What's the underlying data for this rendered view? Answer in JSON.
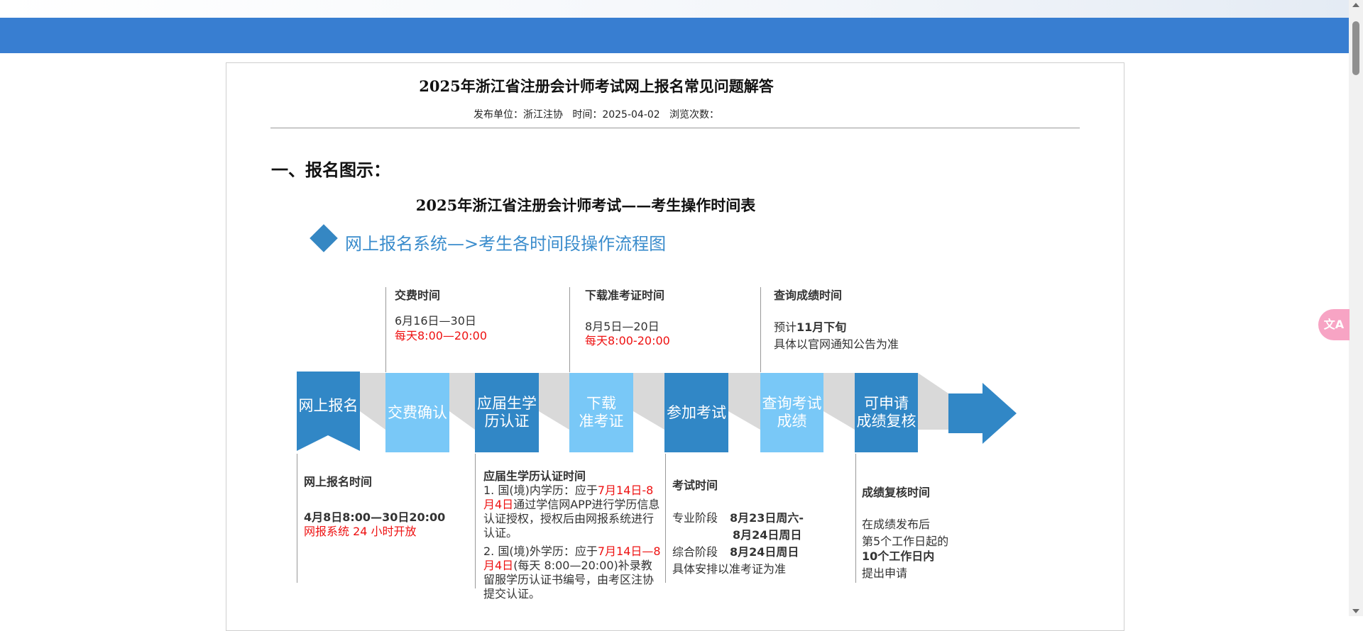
{
  "article": {
    "title": "2025年浙江省注册会计师考试网上报名常见问题解答",
    "meta": "发布单位：浙江注协   时间：2025-04-02   浏览次数："
  },
  "section_heading": "一、报名图示：",
  "schedule_title": "2025年浙江省注册会计师考试——考生操作时间表",
  "flow_title": "网上报名系统—>考生各时间段操作流程图",
  "flow_boxes": [
    {
      "l1": "网上报名",
      "l2": ""
    },
    {
      "l1": "交费确认",
      "l2": ""
    },
    {
      "l1": "应届生学",
      "l2": "历认证"
    },
    {
      "l1": "下载",
      "l2": "准考证"
    },
    {
      "l1": "参加考试",
      "l2": ""
    },
    {
      "l1": "查询考试",
      "l2": "成绩"
    },
    {
      "l1": "可申请",
      "l2": "成绩复核"
    }
  ],
  "top_notes": {
    "pay": {
      "title": "交费时间",
      "date": "6月16日—30日",
      "hours": "每天8:00—20:00"
    },
    "download": {
      "title": "下载准考证时间",
      "date": "8月5日—20日",
      "hours": "每天8:00-20:00"
    },
    "score": {
      "title": "查询成绩时间",
      "line1_prefix": "预计",
      "line1_bold": "11月下旬",
      "line2": "具体以官网通知公告为准"
    }
  },
  "bottom_notes": {
    "register": {
      "title": "网上报名时间",
      "time": "4月8日8:00—30日20:00",
      "note": "网报系统 24 小时开放"
    },
    "cert": {
      "title": "应届生学历认证时间",
      "p1_a": "1. 国(境)内学历：应于",
      "p1_red": "7月14日-8月4日",
      "p1_b": "通过学信网APP进行学历信息认证授权，授权后由网报系统进行认证。",
      "p2_a": "2. 国(境)外学历：应于",
      "p2_red": "7月14日—8月4日",
      "p2_b": "(每天 8:00—20:00)补录教留服学历认证书编号，由考区注协提交认证。"
    },
    "exam": {
      "title": "考试时间",
      "pro_label": "专业阶段",
      "pro_dates_1": "8月23日周六-",
      "pro_dates_2": "8月24日周日",
      "comp_label": "综合阶段",
      "comp_dates": "8月24日周日",
      "note": "具体安排以准考证为准"
    },
    "review": {
      "title": "成绩复核时间",
      "l1": "在成绩发布后",
      "l2": "第5个工作日起的",
      "l3": "10个工作日内",
      "l4": "提出申请"
    }
  },
  "colors": {
    "header_blue": "#387ed1",
    "box_dark": "#3187c6",
    "box_light": "#79c8f7",
    "connector": "#d9d9d9",
    "highlight_red": "#ee1111"
  },
  "widgets": {
    "translate_icon": "translate-icon"
  }
}
